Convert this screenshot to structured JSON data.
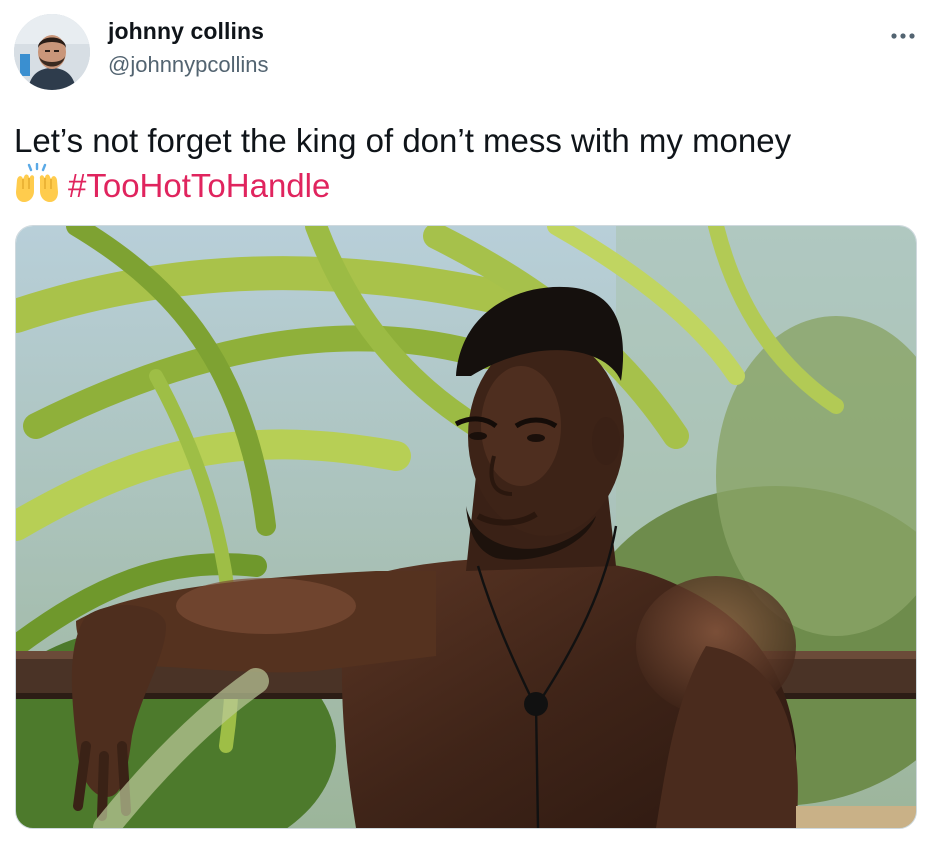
{
  "author": {
    "display_name": "johnny collins",
    "username": "@johnnypcollins",
    "avatar_icon": "avatar-photo"
  },
  "more_menu": {
    "icon": "more-horizontal-icon"
  },
  "tweet": {
    "text_line1": "Let’s not forget the king of don’t mess with my money",
    "emoji": "raising-hands-emoji",
    "hashtag": "#TooHotToHandle"
  },
  "media": {
    "kind": "photo"
  },
  "colors": {
    "text": "#0f1419",
    "secondary_text": "#536471",
    "hashtag": "#e0245e",
    "media_border": "#cfd9de"
  }
}
